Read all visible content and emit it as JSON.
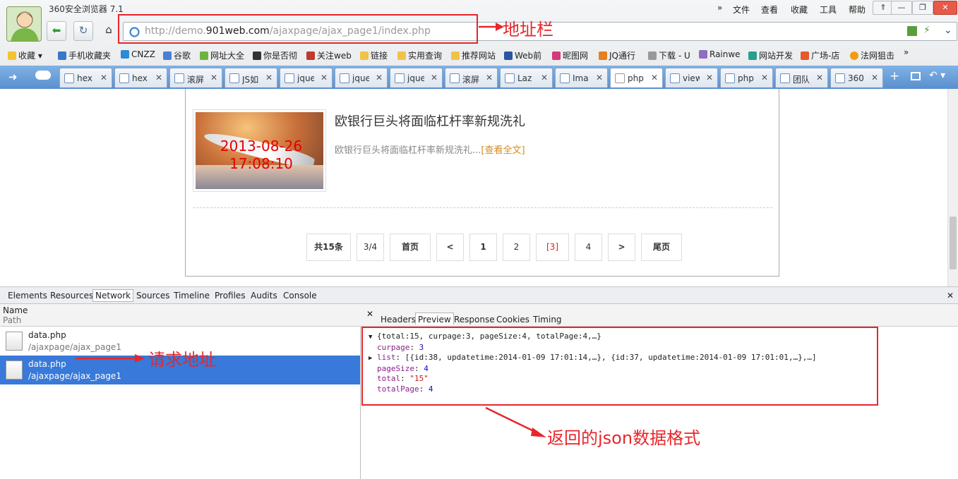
{
  "window": {
    "title": "360安全浏览器 7.1"
  },
  "menu": [
    "文件",
    "查看",
    "收藏",
    "工具",
    "帮助"
  ],
  "window_buttons": [
    "⇑",
    "—",
    "❐",
    "✕"
  ],
  "address_bar": {
    "prefix": "http://demo.",
    "domain": "901web.com",
    "path": "/ajaxpage/ajax_page1/index.php"
  },
  "bookmarks": [
    "收藏",
    "手机收藏夹",
    "CNZZ",
    "谷歌",
    "网址大全",
    "你是否彻",
    "关注web",
    "链接",
    "实用查询",
    "推荐网站",
    "Web前",
    "昵图网",
    "JQ通行",
    "下载 - U",
    "Rainwe",
    "网站开发",
    "广场-店",
    "法网狙击"
  ],
  "tabs": [
    "hex",
    "hex",
    "滚屏",
    "JS如",
    "jque",
    "jque",
    "jque",
    "滚屏",
    "Laz",
    "Ima",
    "php",
    "view",
    "php",
    "团队",
    "360"
  ],
  "article": {
    "image_stamp": [
      "2013-08-26",
      "17:08:10"
    ],
    "title": "欧银行巨头将面临杠杆率新规洗礼",
    "desc": "欧银行巨头将面临杠杆率新规洗礼...",
    "more": "[查看全文]"
  },
  "pagination": [
    "共15条",
    "3/4",
    "首页",
    "<",
    "1",
    "2",
    "[3]",
    "4",
    ">",
    "尾页"
  ],
  "devtools": {
    "tabs": [
      "Elements",
      "Resources",
      "Network",
      "Sources",
      "Timeline",
      "Profiles",
      "Audits",
      "Console"
    ],
    "selected_tab": "Network",
    "columns": {
      "name": "Name",
      "path": "Path"
    },
    "requests": [
      {
        "name": "data.php",
        "path": "/ajaxpage/ajax_page1"
      },
      {
        "name": "data.php",
        "path": "/ajaxpage/ajax_page1"
      }
    ],
    "detail_tabs": [
      "Headers",
      "Preview",
      "Response",
      "Cookies",
      "Timing"
    ],
    "preview": {
      "summary": "{total:15, curpage:3, pageSize:4, totalPage:4,…}",
      "curpage_key": "curpage",
      "curpage_val": "3",
      "list_key": "list",
      "list_val": "[{id:38, updatetime:2014-01-09 17:01:14,…}, {id:37, updatetime:2014-01-09 17:01:01,…},…]",
      "pagesize_key": "pageSize",
      "pagesize_val": "4",
      "total_key": "total",
      "total_val": "\"15\"",
      "totalpage_key": "totalPage",
      "totalpage_val": "4"
    }
  },
  "annotations": {
    "address": "地址栏",
    "request": "请求地址",
    "json": "返回的json数据格式"
  },
  "colors": {
    "annotation": "#e8262b",
    "selected_row": "#3879d9"
  }
}
